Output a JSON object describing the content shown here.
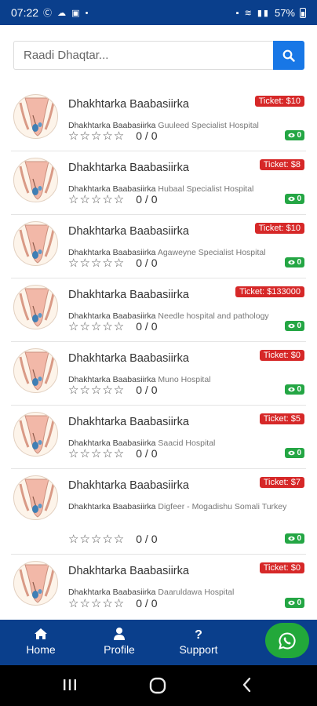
{
  "status_bar": {
    "time": "07:22",
    "left_icons": "Ⓒ ☁ ▣ •",
    "right_icons": "▪ ≋ ▮▮",
    "battery": "57%",
    "colors": {
      "bar": "#0a3f8c"
    }
  },
  "search": {
    "placeholder": "Raadi Dhaqtar...",
    "button_icon": "search-icon"
  },
  "doctors": [
    {
      "name": "Dhakhtarka Baabasiirka",
      "specialty": "Dhakhtarka Baabasiirka",
      "hospital": "Guuleed Specialist Hospital",
      "ticket": "Ticket: $10",
      "rating_count": "0 / 0",
      "views": "0",
      "stars": 0
    },
    {
      "name": "Dhakhtarka Baabasiirka",
      "specialty": "Dhakhtarka Baabasiirka",
      "hospital": "Hubaal Specialist Hospital",
      "ticket": "Ticket: $8",
      "rating_count": "0 / 0",
      "views": "0",
      "stars": 0
    },
    {
      "name": "Dhakhtarka Baabasiirka",
      "specialty": "Dhakhtarka Baabasiirka",
      "hospital": "Agaweyne Specialist Hospital",
      "ticket": "Ticket: $10",
      "rating_count": "0 / 0",
      "views": "0",
      "stars": 0
    },
    {
      "name": "Dhakhtarka Baabasiirka",
      "specialty": "Dhakhtarka Baabasiirka",
      "hospital": "Needle hospital and pathology",
      "ticket": "Ticket: $133000",
      "rating_count": "0 / 0",
      "views": "0",
      "stars": 0
    },
    {
      "name": "Dhakhtarka Baabasiirka",
      "specialty": "Dhakhtarka Baabasiirka",
      "hospital": "Muno Hospital",
      "ticket": "Ticket: $0",
      "rating_count": "0 / 0",
      "views": "0",
      "stars": 0
    },
    {
      "name": "Dhakhtarka Baabasiirka",
      "specialty": "Dhakhtarka Baabasiirka",
      "hospital": "Saacid Hospital",
      "ticket": "Ticket: $5",
      "rating_count": "0 / 0",
      "views": "0",
      "stars": 0
    },
    {
      "name": "Dhakhtarka Baabasiirka",
      "specialty": "Dhakhtarka Baabasiirka",
      "hospital": "Digfeer - Mogadishu Somali Turkey",
      "ticket": "Ticket: $7",
      "rating_count": "0 / 0",
      "views": "0",
      "stars": 0
    },
    {
      "name": "Dhakhtarka Baabasiirka",
      "specialty": "Dhakhtarka Baabasiirka",
      "hospital": "Daaruldawa Hospital",
      "ticket": "Ticket: $0",
      "rating_count": "0 / 0",
      "views": "0",
      "stars": 0
    }
  ],
  "bottom_nav": {
    "home": {
      "label": "Home",
      "icon": "home-icon"
    },
    "profile": {
      "label": "Profile",
      "icon": "user-icon"
    },
    "support": {
      "label": "Support",
      "icon": "question-icon"
    },
    "whatsapp_icon": "whatsapp-icon"
  },
  "system_nav": {
    "recents_icon": "recents-icon",
    "home_icon": "home-circle-icon",
    "back_icon": "back-icon"
  },
  "colors": {
    "primary": "#0a3f8c",
    "search_button": "#1877e6",
    "ticket_badge": "#d62828",
    "views_badge": "#24a644",
    "whatsapp": "#22a83a"
  }
}
